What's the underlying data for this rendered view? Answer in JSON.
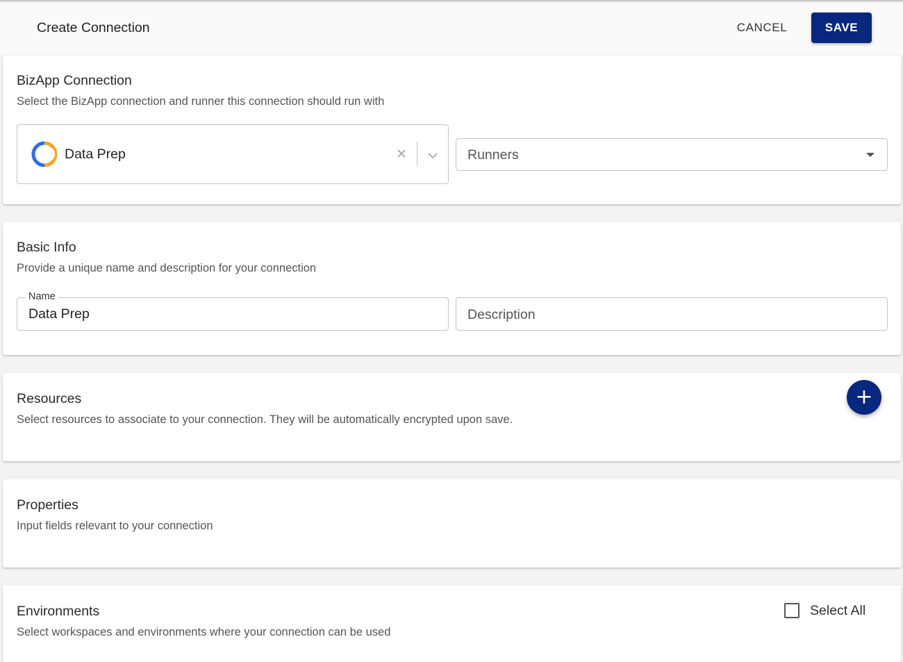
{
  "header": {
    "title": "Create Connection",
    "cancel_label": "CANCEL",
    "save_label": "SAVE"
  },
  "bizapp": {
    "title": "BizApp Connection",
    "subtitle": "Select the BizApp connection and runner this connection should run with",
    "connection_value": "Data Prep",
    "connection_icon": "data-prep-logo-icon",
    "clear_icon": "close-icon",
    "dropdown_icon": "chevron-down-icon",
    "runners_label": "Runners"
  },
  "basic_info": {
    "title": "Basic Info",
    "subtitle": "Provide a unique name and description for your connection",
    "name_label": "Name",
    "name_value": "Data Prep",
    "description_placeholder": "Description"
  },
  "resources": {
    "title": "Resources",
    "subtitle": "Select resources to associate to your connection. They will be automatically encrypted upon save.",
    "add_icon": "+"
  },
  "properties": {
    "title": "Properties",
    "subtitle": "Input fields relevant to your connection"
  },
  "environments": {
    "title": "Environments",
    "subtitle": "Select workspaces and environments where your connection can be used",
    "select_all_label": "Select All",
    "select_all_checked": false
  },
  "colors": {
    "primary": "#08277f",
    "logo_blue": "#2f6fe8",
    "logo_orange": "#f5a623"
  }
}
